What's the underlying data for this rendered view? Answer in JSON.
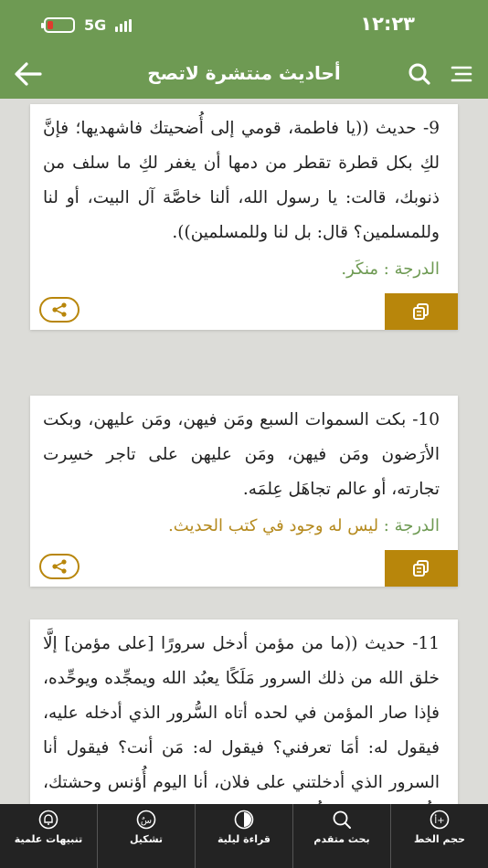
{
  "status": {
    "time": "١٢:٢٣",
    "network": "5G"
  },
  "header": {
    "title": "أحاديث منتشرة لاتصح"
  },
  "cards": [
    {
      "text": "9- حديث ((يا فاطمة، قومي إلى أُضحيتك فاشهديها؛ فإنَّ لكِ بكل قطرة تقطر من دمها أن يغفر لكِ ما سلف من ذنوبك، قالت: يا رسول الله، ألنا خاصَّة آل البيت، أو لنا وللمسلمين؟ قال: بل لنا وللمسلمين)).",
      "grade_label": "الدرجة :",
      "grade_value": "منكَر."
    },
    {
      "text": "10- بكت السموات السبع ومَن فيهن، ومَن عليهن، وبكت الأرَضون ومَن فيهن، ومَن عليهن على تاجر خسِرت تجارته، أو عالم تجاهَل عِلمَه.",
      "grade_label": "الدرجة :",
      "grade_value": "ليس له وجود في كتب الحديث."
    },
    {
      "text": "11- حديث ((ما من مؤمن أدخل سرورًا [على مؤمن] إلَّا خلق الله من ذلك السرور مَلَكًا يعبُد الله ويمجِّده ويوحِّده، فإذا صار المؤمن في لحده أتاه السُّرور الذي أدخله عليه، فيقول له: أمَا تعرفني؟ فيقول له: مَن أنت؟ فيقول أنا السرور الذي أدخلتني على فلان، أنا اليوم أُؤنس وحشتك، وأُلقِّنك حُجَّتك، وأُثبِّتك بالقول الثابت، وأشهد بك مشاهد القيامة"
    }
  ],
  "bottom_tabs": [
    {
      "label": "حجم الخط",
      "icon": "font-size-icon"
    },
    {
      "label": "بحث متقدم",
      "icon": "advanced-search-icon"
    },
    {
      "label": "قراءة ليلية",
      "icon": "night-mode-icon"
    },
    {
      "label": "تشكيل",
      "icon": "diacritics-icon"
    },
    {
      "label": "تنبيهات علمية",
      "icon": "notifications-bell-icon"
    }
  ],
  "colors": {
    "primary": "#6e9a53",
    "accent": "#b8860b",
    "grade_gold": "#b58a1e"
  }
}
